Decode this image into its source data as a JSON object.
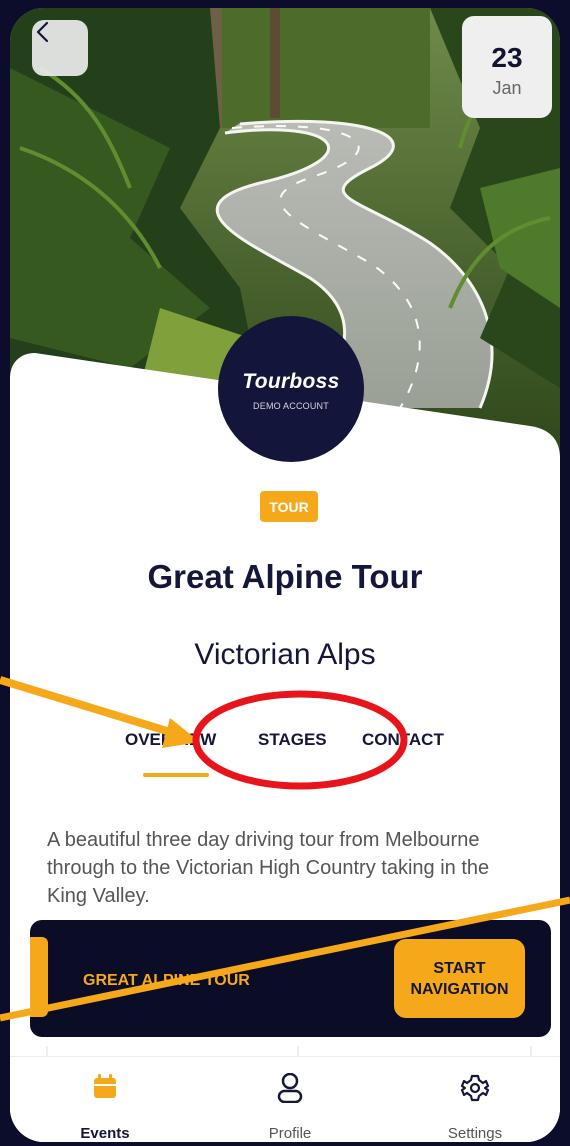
{
  "header": {
    "back_icon": "chevron-left-icon",
    "date_day": "23",
    "date_month": "Jan"
  },
  "logo": {
    "wordmark": "Tourboss",
    "subtitle": "DEMO ACCOUNT"
  },
  "event": {
    "tag": "TOUR",
    "title": "Great Alpine Tour",
    "location": "Victorian Alps",
    "description": "A beautiful three day driving tour from Melbourne through to the Victorian High Country taking in the King Valley."
  },
  "tabs": [
    {
      "label": "OVERVIEW",
      "active": true
    },
    {
      "label": "STAGES",
      "active": false
    },
    {
      "label": "CONTACT",
      "active": false
    }
  ],
  "banner": {
    "title": "GREAT ALPINE TOUR",
    "button_line1": "START",
    "button_line2": "NAVIGATION"
  },
  "bottom_nav": [
    {
      "label": "Events",
      "icon": "calendar-icon",
      "active": true
    },
    {
      "label": "Profile",
      "icon": "user-icon",
      "active": false
    },
    {
      "label": "Settings",
      "icon": "gear-icon",
      "active": false
    }
  ],
  "colors": {
    "accent": "#f5a91a",
    "navy": "#14163a",
    "annotation_arrow": "#f5a91a",
    "annotation_circle": "#e8141b"
  }
}
